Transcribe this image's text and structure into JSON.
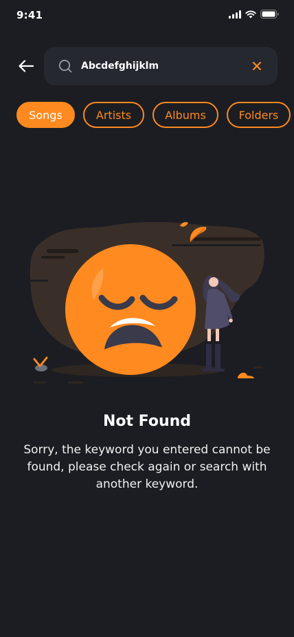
{
  "status_bar": {
    "time": "9:41"
  },
  "search": {
    "query": "Abcdefghijklm"
  },
  "filters": [
    {
      "label": "Songs",
      "active": true
    },
    {
      "label": "Artists",
      "active": false
    },
    {
      "label": "Albums",
      "active": false
    },
    {
      "label": "Folders",
      "active": false
    }
  ],
  "empty_state": {
    "title": "Not Found",
    "message": "Sorry, the keyword you entered cannot be found, please check again or search with another keyword."
  },
  "icons": [
    "back-arrow-icon",
    "search-icon",
    "close-icon",
    "signal-icon",
    "wifi-icon",
    "battery-icon"
  ],
  "colors": {
    "accent": "#ff8a1f",
    "background": "#1c1d22",
    "search_bg": "#262830"
  }
}
